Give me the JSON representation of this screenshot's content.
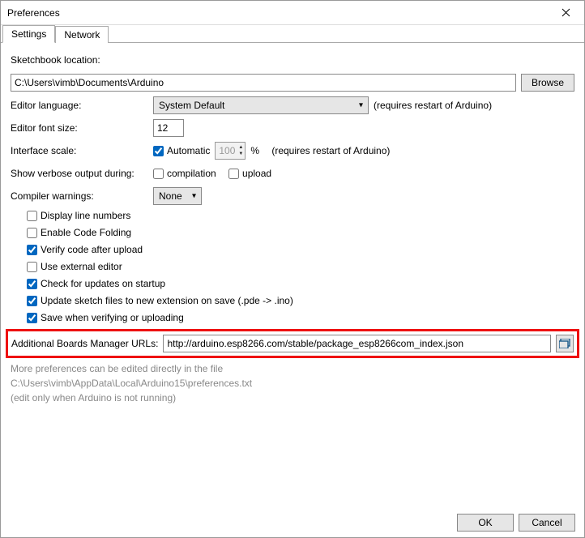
{
  "window": {
    "title": "Preferences"
  },
  "tabs": {
    "settings": "Settings",
    "network": "Network"
  },
  "labels": {
    "sketchbook": "Sketchbook location:",
    "editorLanguage": "Editor language:",
    "editorFontSize": "Editor font size:",
    "interfaceScale": "Interface scale:",
    "verbose": "Show verbose output during:",
    "compilerWarnings": "Compiler warnings:",
    "boardsUrls": "Additional Boards Manager URLs:",
    "morePrefs": "More preferences can be edited directly in the file",
    "prefsPath": "C:\\Users\\vimb\\AppData\\Local\\Arduino15\\preferences.txt",
    "editNote": "(edit only when Arduino is not running)",
    "restartNote": "(requires restart of Arduino)",
    "restartNote2": "(requires restart of Arduino)"
  },
  "values": {
    "sketchbookPath": "C:\\Users\\vimb\\Documents\\Arduino",
    "language": "System Default",
    "fontSize": "12",
    "scale": "100",
    "percent": "%",
    "warnings": "None",
    "boardsUrl": "http://arduino.esp8266.com/stable/package_esp8266com_index.json"
  },
  "checks": {
    "automatic": "Automatic",
    "compilation": "compilation",
    "upload": "upload",
    "displayLineNumbers": "Display line numbers",
    "enableCodeFolding": "Enable Code Folding",
    "verifyAfterUpload": "Verify code after upload",
    "externalEditor": "Use external editor",
    "checkUpdates": "Check for updates on startup",
    "updateExt": "Update sketch files to new extension on save (.pde -> .ino)",
    "saveOnVerify": "Save when verifying or uploading"
  },
  "buttons": {
    "browse": "Browse",
    "ok": "OK",
    "cancel": "Cancel"
  }
}
